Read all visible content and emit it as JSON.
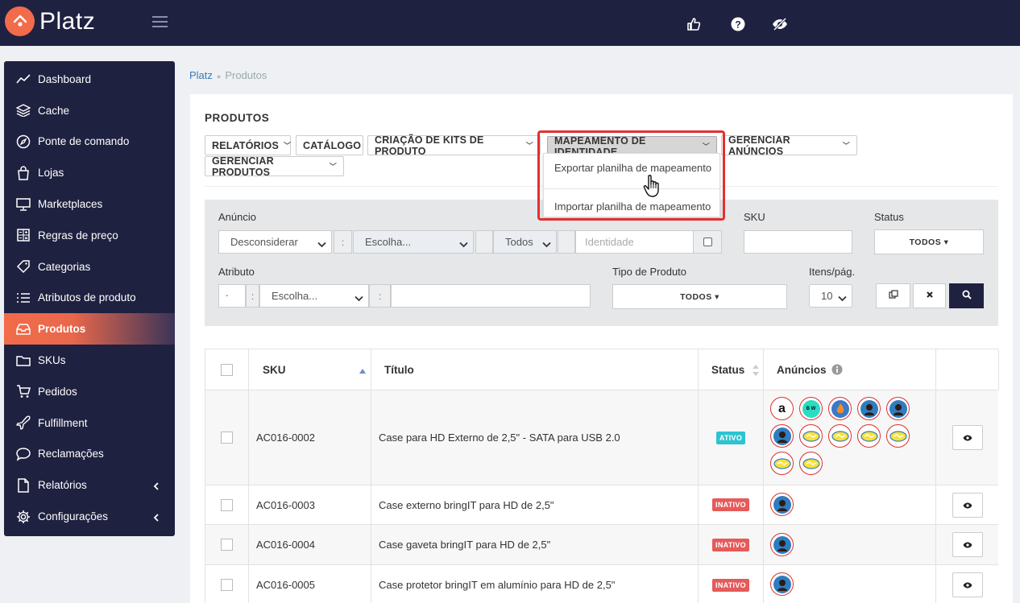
{
  "app": {
    "brand": "Platz"
  },
  "sidebar": {
    "items": [
      {
        "label": "Dashboard",
        "icon": "trend-icon"
      },
      {
        "label": "Cache",
        "icon": "layers-icon"
      },
      {
        "label": "Ponte de comando",
        "icon": "compass-icon"
      },
      {
        "label": "Lojas",
        "icon": "bag-icon"
      },
      {
        "label": "Marketplaces",
        "icon": "monitor-icon"
      },
      {
        "label": "Regras de preço",
        "icon": "calculator-icon"
      },
      {
        "label": "Categorias",
        "icon": "tag-icon"
      },
      {
        "label": "Atributos de produto",
        "icon": "list-icon"
      },
      {
        "label": "Produtos",
        "icon": "inbox-icon",
        "active": true
      },
      {
        "label": "SKUs",
        "icon": "folder-icon"
      },
      {
        "label": "Pedidos",
        "icon": "cart-icon"
      },
      {
        "label": "Fulfillment",
        "icon": "plane-icon"
      },
      {
        "label": "Reclamações",
        "icon": "chat-icon"
      },
      {
        "label": "Relatórios",
        "icon": "file-icon",
        "caret": true
      },
      {
        "label": "Configurações",
        "icon": "gear-icon",
        "caret": true
      }
    ]
  },
  "breadcrumb": {
    "root": "Platz",
    "current": "Produtos"
  },
  "page": {
    "title": "PRODUTOS"
  },
  "toolbar": {
    "relatorios": "RELATÓRIOS",
    "catalogo": "CATÁLOGO",
    "kits": "CRIAÇÃO DE KITS DE PRODUTO",
    "mapeamento": "MAPEAMENTO DE IDENTIDADE",
    "anuncios": "GERENCIAR ANÚNCIOS",
    "produtos": "GERENCIAR PRODUTOS"
  },
  "dropdown": {
    "export": "Exportar planilha de mapeamento",
    "import": "Importar planilha de mapeamento"
  },
  "filters": {
    "anuncio_label": "Anúncio",
    "anuncio_mode": "Desconsiderar",
    "anuncio_choice": "Escolha...",
    "anuncio_scope": "Todos",
    "identidade_placeholder": "Identidade",
    "sku_label": "SKU",
    "status_label": "Status",
    "status_value": "TODOS ▾",
    "atributo_label": "Atributo",
    "atributo_small": "-",
    "atributo_choice": "Escolha...",
    "tipo_label": "Tipo de Produto",
    "tipo_value": "TODOS ▾",
    "itens_label": "Itens/pág.",
    "itens_value": "10",
    "colon": ":"
  },
  "table": {
    "headers": {
      "sku": "SKU",
      "titulo": "Título",
      "status": "Status",
      "anuncios": "Anúncios"
    },
    "rows": [
      {
        "sku": "AC016-0002",
        "titulo": "Case para HD Externo de 2,5\" - SATA para USB 2.0",
        "status": "ATIVO"
      },
      {
        "sku": "AC016-0003",
        "titulo": "Case externo bringIT para HD de 2,5\"",
        "status": "INATIVO"
      },
      {
        "sku": "AC016-0004",
        "titulo": "Case gaveta bringIT para HD de 2,5\"",
        "status": "INATIVO"
      },
      {
        "sku": "AC016-0005",
        "titulo": "Case protetor bringIT em alumínio para HD de 2,5\"",
        "status": "INATIVO"
      }
    ]
  },
  "marketplace_marks": {
    "amazon": "a",
    "bw": "B W"
  },
  "colors": {
    "navy": "#1f2140",
    "accent": "#f26b4a",
    "active_badge": "#2dc3d1",
    "inactive_badge": "#e65a5a",
    "highlight": "#e03131"
  }
}
